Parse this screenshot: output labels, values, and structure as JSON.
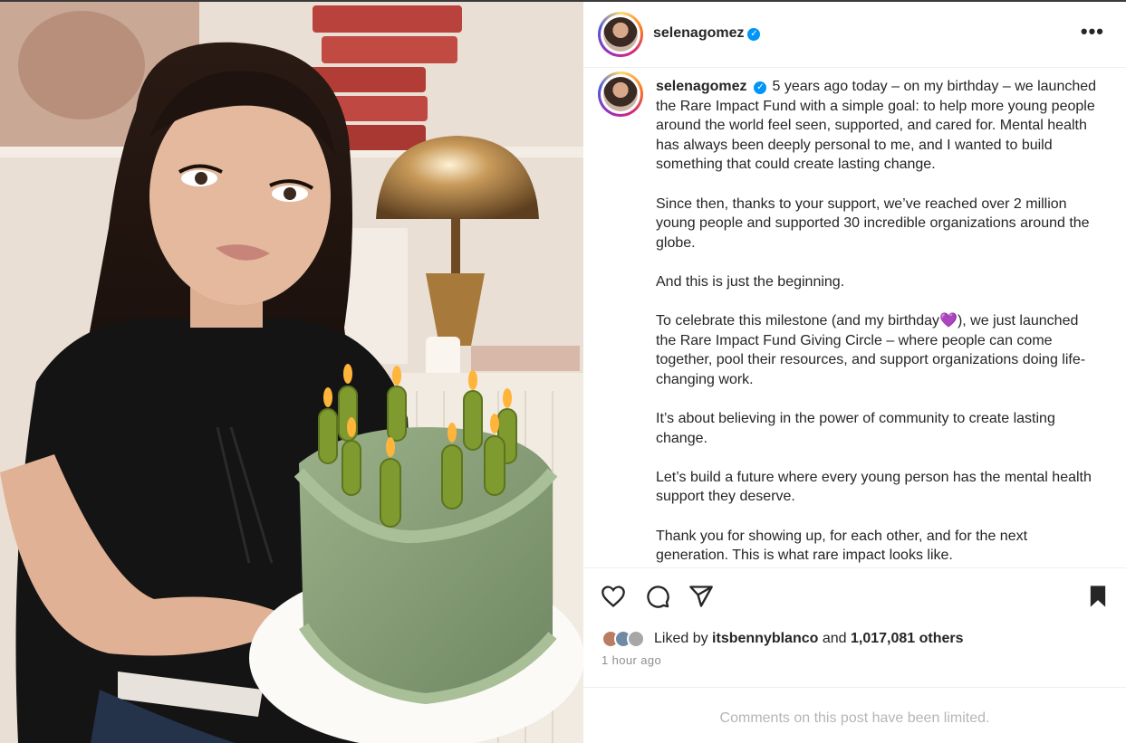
{
  "header": {
    "username": "selenagomez",
    "verified_icon": "verified-badge-icon",
    "more_icon": "more-options-icon",
    "more_glyph": "•••"
  },
  "caption": {
    "username": "selenagomez",
    "paragraphs": [
      "5 years ago today – on my birthday – we launched the Rare Impact Fund with a simple goal: to help more young people around the world feel seen, supported, and cared for. Mental health has always been deeply personal to me, and I wanted to build something that could create lasting change.",
      "Since then, thanks to your support, we’ve reached over 2 million young people and supported 30 incredible organizations around the globe.",
      "And this is just the beginning.",
      "To celebrate this milestone (and my birthday💜), we just launched the Rare Impact Fund Giving Circle – where people can come together, pool their resources, and support organizations doing life-changing work.",
      "It’s about believing in the power of community to create lasting change.",
      "Let’s build a future where every young person has the mental health support they deserve.",
      "Thank you for showing up, for each other, and for the next generation. This is what rare impact looks like."
    ]
  },
  "actions": {
    "like_icon": "heart-icon",
    "comment_icon": "comment-icon",
    "share_icon": "share-icon",
    "save_icon": "bookmark-icon"
  },
  "likes": {
    "prefix": "Liked by",
    "user": "itsbennyblanco",
    "middle": "and",
    "count": "1,017,081 others"
  },
  "timestamp": "1 hour ago",
  "comments_notice": "Comments on this post have been limited.",
  "colors": {
    "accent": "#0095f6",
    "text": "#262626",
    "muted": "#8e8e8e",
    "cake": "#8fa57e"
  }
}
